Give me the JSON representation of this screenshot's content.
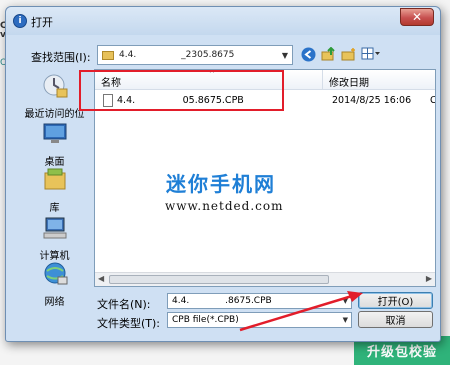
{
  "background": {
    "left_text": "C\nv",
    "left_teal": "ON",
    "green_button": "升级包校验"
  },
  "dialog": {
    "title": "打开",
    "title_icon": "i",
    "close_glyph": "✕",
    "look_in_label": "查找范围(I):",
    "look_in_value": "4.4.     _2305.8675",
    "places": [
      {
        "label": "最近访问的位置",
        "icon": "recent-places-icon"
      },
      {
        "label": "桌面",
        "icon": "desktop-icon"
      },
      {
        "label": "库",
        "icon": "libraries-icon"
      },
      {
        "label": "计算机",
        "icon": "computer-icon"
      },
      {
        "label": "网络",
        "icon": "network-icon"
      }
    ],
    "columns": {
      "name": "名称",
      "date_modified": "修改日期"
    },
    "files": [
      {
        "name": "4.4.     05.8675.CPB",
        "date": "2014/8/25 16:06",
        "extra": "C"
      }
    ],
    "watermark": {
      "cn": "迷你手机网",
      "url": "www.netded.com"
    },
    "file_name_label": "文件名(N):",
    "file_name_value": "4.4.    .8675.CPB",
    "file_type_label": "文件类型(T):",
    "file_type_value": "CPB file(*.CPB)",
    "open_button": "打开(O)",
    "cancel_button": "取消"
  },
  "colors": {
    "highlight_box": "#e21d2a",
    "watermark": "#1f7fd6",
    "accent_green": "#2fb37a"
  }
}
